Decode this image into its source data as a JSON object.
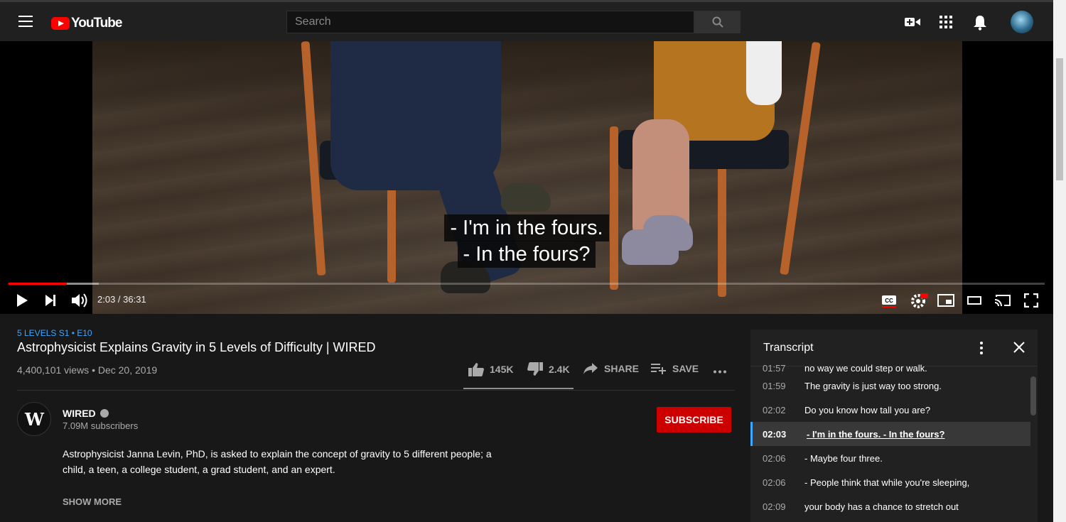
{
  "header": {
    "logo_text": "YouTube",
    "search_placeholder": "Search"
  },
  "video": {
    "caption_line1": "- I'm in the fours.",
    "caption_line2": "- In the fours?",
    "current_time": "2:03",
    "duration": "36:31",
    "time_display": "2:03 / 36:31",
    "progress_fraction": 0.0562,
    "buffered_fraction": 0.087
  },
  "info": {
    "series_badge": "5 LEVELS  S1 • E10",
    "title": "Astrophysicist Explains Gravity in 5 Levels of Difficulty | WIRED",
    "meta": "4,400,101 views • Dec 20, 2019",
    "likes": "145K",
    "dislikes": "2.4K",
    "share_label": "SHARE",
    "save_label": "SAVE"
  },
  "channel": {
    "name": "WIRED",
    "subscribers": "7.09M subscribers",
    "subscribe_label": "SUBSCRIBE",
    "avatar_letter": "W",
    "description": "Astrophysicist Janna Levin, PhD, is asked to explain the concept of gravity to 5 different people; a child, a teen, a college student, a grad student, and an expert.",
    "show_more": "SHOW MORE"
  },
  "transcript": {
    "title": "Transcript",
    "partial_row": {
      "time": "01:57",
      "text": "no way we could step or walk."
    },
    "rows": [
      {
        "time": "01:59",
        "text": "The gravity is just way too strong."
      },
      {
        "time": "02:02",
        "text": "Do you know how tall you are?"
      },
      {
        "time": "02:03",
        "text": "- I'm in the fours. - In the fours?"
      },
      {
        "time": "02:06",
        "text": "- Maybe four three."
      },
      {
        "time": "02:06",
        "text": "- People think that while you're sleeping,"
      },
      {
        "time": "02:09",
        "text": "your body has a chance to stretch out"
      }
    ],
    "active_index": 2
  },
  "colors": {
    "brand_red": "#ff0000",
    "subscribe_red": "#cc0000",
    "accent_blue": "#3ea6ff",
    "background": "#181818",
    "header_bg": "#202020"
  }
}
